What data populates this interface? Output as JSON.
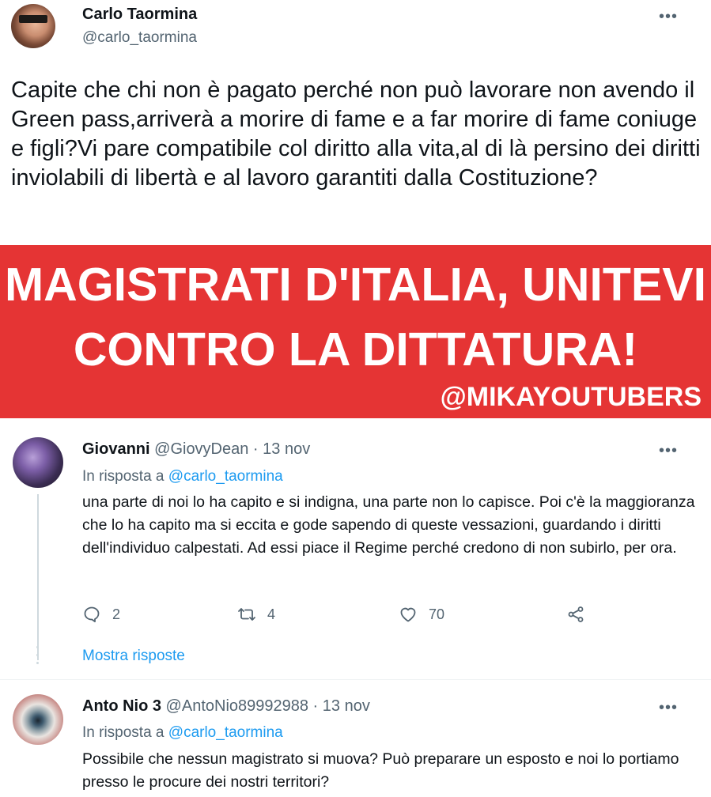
{
  "main_tweet": {
    "author_name": "Carlo Taormina",
    "author_handle": "@carlo_taormina",
    "more_label": "•••",
    "text": "Capite che chi non è pagato perché non può lavorare non avendo il Green pass,arriverà a morire di fame e a far morire di fame coniuge e figli?Vi pare compatibile col diritto alla vita,al di là persino dei diritti inviolabili di libertà e al lavoro garantiti  dalla Costituzione?"
  },
  "banner": {
    "line1": "MAGISTRATI D'ITALIA, UNITEVI",
    "line2": "CONTRO LA DITTATURA!",
    "credit": "@MIKAYOUTUBERS",
    "background": "#e53434"
  },
  "replies": [
    {
      "name": "Giovanni",
      "meta": " @GiovyDean · 13 nov",
      "reply_to_prefix": "In risposta a ",
      "reply_to_handle": "@carlo_taormina",
      "text": "una parte di noi lo ha capito e si indigna, una parte non lo capisce. Poi c'è la maggioranza che lo ha capito ma si eccita e gode sapendo di queste vessazioni, guardando i diritti dell'individuo calpestati. Ad essi piace il Regime perché credono di non subirlo, per ora.",
      "reply_count": "2",
      "retweet_count": "4",
      "like_count": "70",
      "show_replies": "Mostra risposte",
      "more_label": "•••"
    },
    {
      "name": "Anto Nio 3",
      "meta": " @AntoNio89992988 · 13 nov",
      "reply_to_prefix": "In risposta a ",
      "reply_to_handle": "@carlo_taormina",
      "text": "Possibile che nessun magistrato si muova? Può preparare un esposto e noi lo portiamo presso le procure dei nostri territori?",
      "more_label": "•••"
    }
  ],
  "colors": {
    "text": "#0f1419",
    "muted": "#536471",
    "link": "#1d9bf0"
  },
  "icons": {
    "reply": "reply-icon",
    "retweet": "retweet-icon",
    "like": "heart-icon",
    "share": "share-icon",
    "more": "more-icon"
  }
}
